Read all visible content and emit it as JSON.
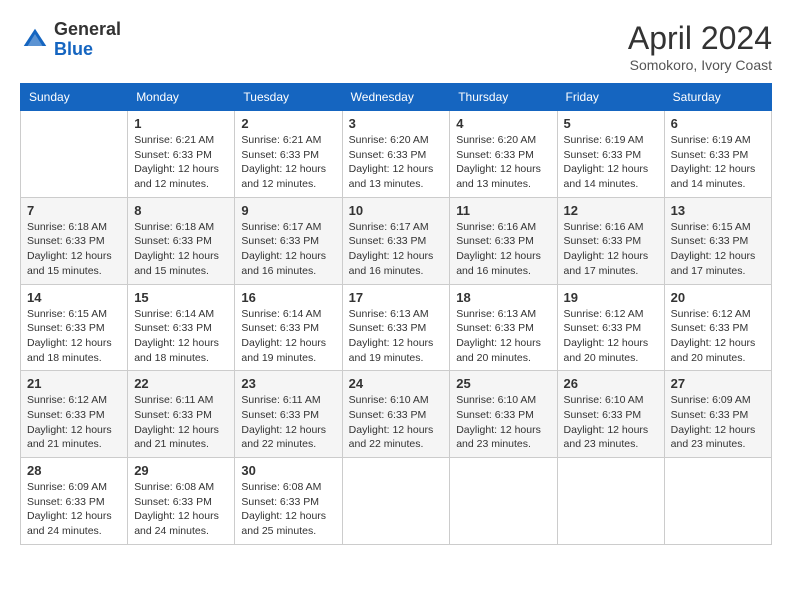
{
  "logo": {
    "general": "General",
    "blue": "Blue"
  },
  "title": "April 2024",
  "subtitle": "Somokoro, Ivory Coast",
  "days_header": [
    "Sunday",
    "Monday",
    "Tuesday",
    "Wednesday",
    "Thursday",
    "Friday",
    "Saturday"
  ],
  "weeks": [
    [
      {
        "day": "",
        "info": ""
      },
      {
        "day": "1",
        "info": "Sunrise: 6:21 AM\nSunset: 6:33 PM\nDaylight: 12 hours and 12 minutes."
      },
      {
        "day": "2",
        "info": "Sunrise: 6:21 AM\nSunset: 6:33 PM\nDaylight: 12 hours and 12 minutes."
      },
      {
        "day": "3",
        "info": "Sunrise: 6:20 AM\nSunset: 6:33 PM\nDaylight: 12 hours and 13 minutes."
      },
      {
        "day": "4",
        "info": "Sunrise: 6:20 AM\nSunset: 6:33 PM\nDaylight: 12 hours and 13 minutes."
      },
      {
        "day": "5",
        "info": "Sunrise: 6:19 AM\nSunset: 6:33 PM\nDaylight: 12 hours and 14 minutes."
      },
      {
        "day": "6",
        "info": "Sunrise: 6:19 AM\nSunset: 6:33 PM\nDaylight: 12 hours and 14 minutes."
      }
    ],
    [
      {
        "day": "7",
        "info": "Sunrise: 6:18 AM\nSunset: 6:33 PM\nDaylight: 12 hours and 15 minutes."
      },
      {
        "day": "8",
        "info": "Sunrise: 6:18 AM\nSunset: 6:33 PM\nDaylight: 12 hours and 15 minutes."
      },
      {
        "day": "9",
        "info": "Sunrise: 6:17 AM\nSunset: 6:33 PM\nDaylight: 12 hours and 16 minutes."
      },
      {
        "day": "10",
        "info": "Sunrise: 6:17 AM\nSunset: 6:33 PM\nDaylight: 12 hours and 16 minutes."
      },
      {
        "day": "11",
        "info": "Sunrise: 6:16 AM\nSunset: 6:33 PM\nDaylight: 12 hours and 16 minutes."
      },
      {
        "day": "12",
        "info": "Sunrise: 6:16 AM\nSunset: 6:33 PM\nDaylight: 12 hours and 17 minutes."
      },
      {
        "day": "13",
        "info": "Sunrise: 6:15 AM\nSunset: 6:33 PM\nDaylight: 12 hours and 17 minutes."
      }
    ],
    [
      {
        "day": "14",
        "info": "Sunrise: 6:15 AM\nSunset: 6:33 PM\nDaylight: 12 hours and 18 minutes."
      },
      {
        "day": "15",
        "info": "Sunrise: 6:14 AM\nSunset: 6:33 PM\nDaylight: 12 hours and 18 minutes."
      },
      {
        "day": "16",
        "info": "Sunrise: 6:14 AM\nSunset: 6:33 PM\nDaylight: 12 hours and 19 minutes."
      },
      {
        "day": "17",
        "info": "Sunrise: 6:13 AM\nSunset: 6:33 PM\nDaylight: 12 hours and 19 minutes."
      },
      {
        "day": "18",
        "info": "Sunrise: 6:13 AM\nSunset: 6:33 PM\nDaylight: 12 hours and 20 minutes."
      },
      {
        "day": "19",
        "info": "Sunrise: 6:12 AM\nSunset: 6:33 PM\nDaylight: 12 hours and 20 minutes."
      },
      {
        "day": "20",
        "info": "Sunrise: 6:12 AM\nSunset: 6:33 PM\nDaylight: 12 hours and 20 minutes."
      }
    ],
    [
      {
        "day": "21",
        "info": "Sunrise: 6:12 AM\nSunset: 6:33 PM\nDaylight: 12 hours and 21 minutes."
      },
      {
        "day": "22",
        "info": "Sunrise: 6:11 AM\nSunset: 6:33 PM\nDaylight: 12 hours and 21 minutes."
      },
      {
        "day": "23",
        "info": "Sunrise: 6:11 AM\nSunset: 6:33 PM\nDaylight: 12 hours and 22 minutes."
      },
      {
        "day": "24",
        "info": "Sunrise: 6:10 AM\nSunset: 6:33 PM\nDaylight: 12 hours and 22 minutes."
      },
      {
        "day": "25",
        "info": "Sunrise: 6:10 AM\nSunset: 6:33 PM\nDaylight: 12 hours and 23 minutes."
      },
      {
        "day": "26",
        "info": "Sunrise: 6:10 AM\nSunset: 6:33 PM\nDaylight: 12 hours and 23 minutes."
      },
      {
        "day": "27",
        "info": "Sunrise: 6:09 AM\nSunset: 6:33 PM\nDaylight: 12 hours and 23 minutes."
      }
    ],
    [
      {
        "day": "28",
        "info": "Sunrise: 6:09 AM\nSunset: 6:33 PM\nDaylight: 12 hours and 24 minutes."
      },
      {
        "day": "29",
        "info": "Sunrise: 6:08 AM\nSunset: 6:33 PM\nDaylight: 12 hours and 24 minutes."
      },
      {
        "day": "30",
        "info": "Sunrise: 6:08 AM\nSunset: 6:33 PM\nDaylight: 12 hours and 25 minutes."
      },
      {
        "day": "",
        "info": ""
      },
      {
        "day": "",
        "info": ""
      },
      {
        "day": "",
        "info": ""
      },
      {
        "day": "",
        "info": ""
      }
    ]
  ]
}
